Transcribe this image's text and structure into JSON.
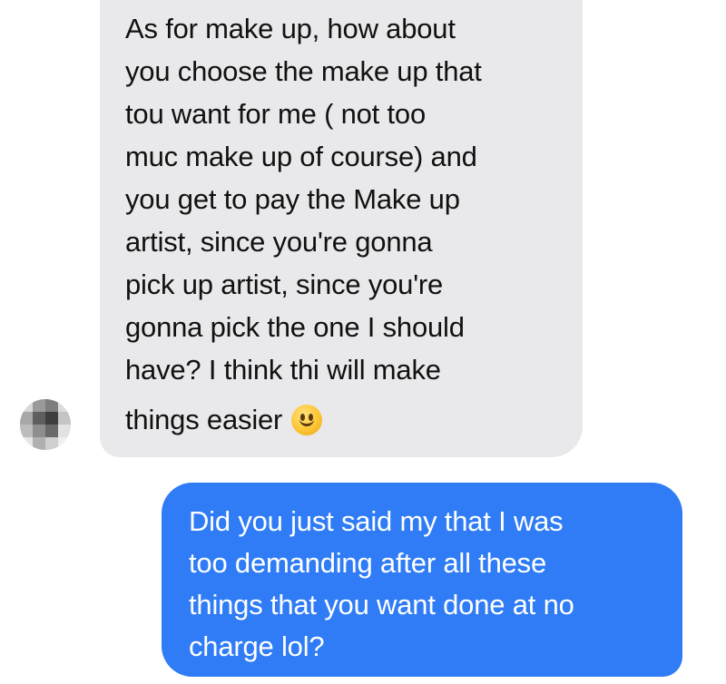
{
  "thread": {
    "incoming_message": {
      "lines": [
        "As for make up, how about",
        "you choose the make up that",
        "tou want for me ( not too",
        "muc make up of course) and",
        "you get to pay the Make up",
        "artist, since you're gonna",
        "pick up artist, since you're",
        "gonna pick the one I should",
        "have? I think thi will make",
        "things easier"
      ],
      "emoji": "slightly-smiling-face-icon",
      "bubble_color": "#e9e9eb"
    },
    "outgoing_message": {
      "lines": [
        "Did you just said my that I was",
        "too demanding after all these",
        "things that you want done at no",
        "charge lol?"
      ],
      "bubble_color": "#2f7cf6"
    },
    "avatar": "pixelated-avatar"
  }
}
